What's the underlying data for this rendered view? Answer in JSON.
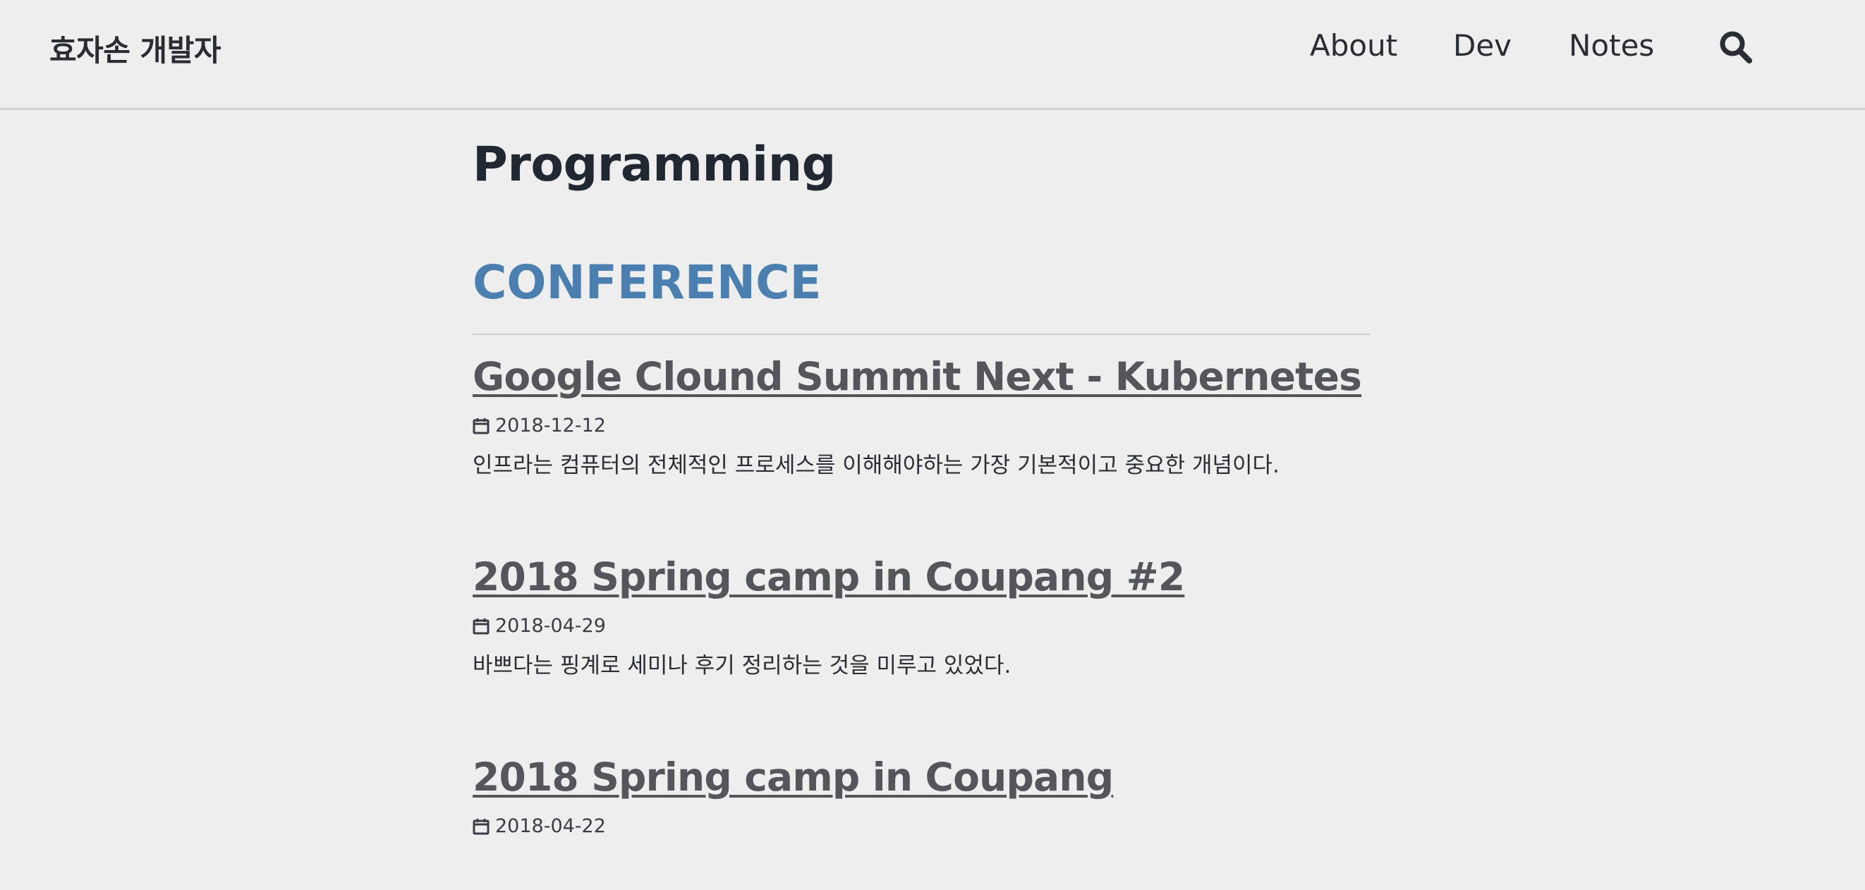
{
  "header": {
    "site_title": "효자손 개발자",
    "nav": [
      {
        "label": "About"
      },
      {
        "label": "Dev"
      },
      {
        "label": "Notes"
      }
    ],
    "search_icon": "search-icon"
  },
  "main": {
    "page_title": "Programming",
    "category": {
      "title": "CONFERENCE",
      "color": "#4a7fb0"
    },
    "posts": [
      {
        "title": "Google Clound Summit Next - Kubernetes",
        "date": "2018-12-12",
        "excerpt": "인프라는 컴퓨터의 전체적인 프로세스를 이해해야하는 가장 기본적이고 중요한 개념이다."
      },
      {
        "title": "2018 Spring camp in Coupang #2",
        "date": "2018-04-29",
        "excerpt": "바쁘다는 핑계로 세미나 후기 정리하는 것을 미루고 있었다."
      },
      {
        "title": "2018 Spring camp in Coupang",
        "date": "2018-04-22",
        "excerpt": ""
      }
    ]
  }
}
